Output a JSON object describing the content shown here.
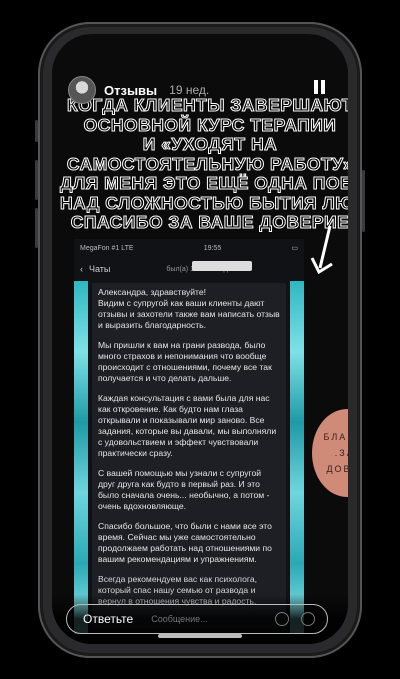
{
  "story": {
    "author": "Отзывы",
    "time": "19 нед.",
    "headline": [
      "КОГДА КЛИЕНТЫ ЗАВЕРШАЮТ",
      "ОСНОВНОЙ КУРС ТЕРАПИИ",
      "И «УХОДЯТ НА",
      "САМОСТОЯТЕЛЬНУЮ РАБОТУ»",
      "ДЛЯ МЕНЯ ЭТО ЕЩЁ ОДНА ПОБЕДА",
      "НАД СЛОЖНОСТЬЮ БЫТИЯ ЛЮДЕЙ",
      "СПАСИБО ЗА ВАШЕ ДОВЕРИЕ"
    ],
    "stamp": [
      "БЛАГОД",
      ".ЗА.",
      "ДОВЕР"
    ],
    "reply_label": "Ответьте",
    "reply_placeholder": "Сообщение..."
  },
  "screenshot": {
    "carrier": "MegaFon #1 LTE",
    "time": "19:55",
    "back_label": "Чаты",
    "last_seen": "был(а) 1 час назад",
    "paragraphs": [
      "Александра, здравствуйте!\nВидим с супругой как ваши клиенты дают отзывы и захотели также вам написать отзыв и выразить благодарность.",
      "Мы пришли к вам на грани развода, было много страхов и непонимания что вообще происходит с отношениями, почему все так получается и что делать дальше.",
      "Каждая консультация с вами была для нас как откровение. Как будто нам глаза открывали и показывали мир заново. Все задания, которые вы давали, мы выполняли с удовольствием и эффект чувствовали практически сразу.",
      "С вашей помощью мы узнали с супругой друг друга как будто в первый раз. И это было сначала очень... необычно, а потом - очень вдохновляюще.",
      "Спасибо большое, что были с нами все это время. Сейчас мы уже самостоятельно продолжаем работать над отношениями по вашим рекомендациям и упражнениям.",
      "Всегда рекомендуем вас как психолога, который спас нашу семью от развода и вернул в отношения чувства и радость."
    ]
  }
}
